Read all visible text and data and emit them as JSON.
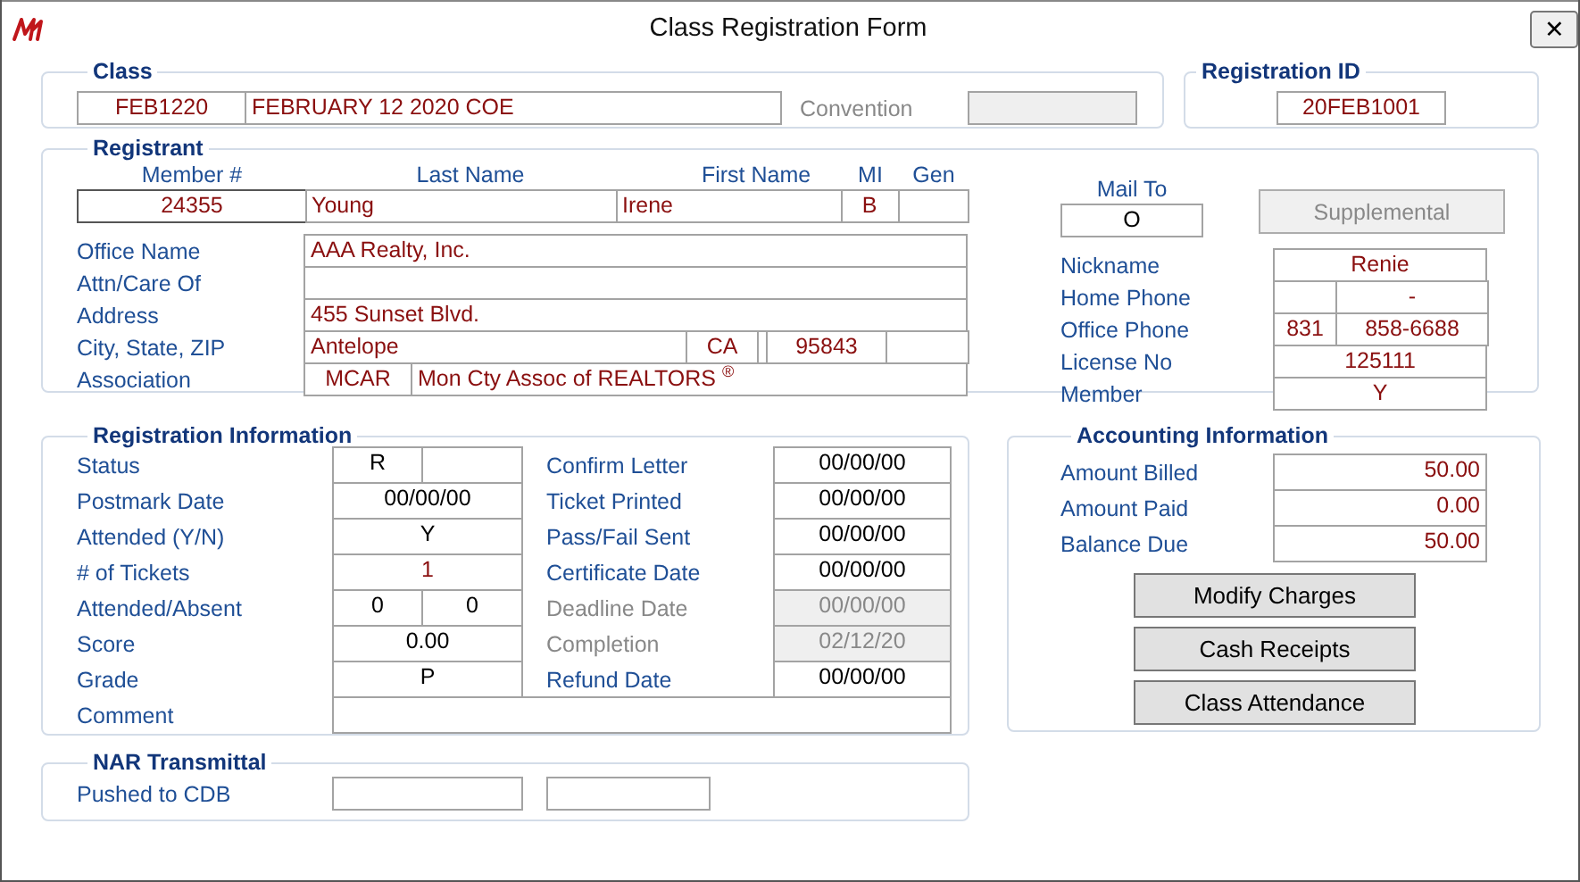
{
  "window": {
    "title": "Class Registration Form",
    "close_glyph": "✕"
  },
  "class_group": {
    "title": "Class",
    "code": "FEB1220",
    "name": "FEBRUARY 12 2020 COE",
    "convention": {
      "label": "Convention",
      "disabled": true
    }
  },
  "registration_id": {
    "title": "Registration ID",
    "value": "20FEB1001"
  },
  "registrant": {
    "title": "Registrant",
    "columns": [
      {
        "header": "Member #",
        "value": "24355"
      },
      {
        "header": "Last Name",
        "value": "Young"
      },
      {
        "header": "First Name",
        "value": "Irene"
      },
      {
        "header": "MI",
        "value": "B"
      },
      {
        "header": "Gen"
      }
    ],
    "mail_to": {
      "label": "Mail To",
      "value": "O"
    },
    "supplemental": {
      "label": "Supplemental",
      "disabled": true
    },
    "rows": [
      {
        "label": "Office Name",
        "kind": "single",
        "values": [
          "AAA Realty, Inc."
        ]
      },
      {
        "label": "Attn/Care Of",
        "kind": "single"
      },
      {
        "label": "Address",
        "kind": "single",
        "values": [
          "455 Sunset Blvd."
        ]
      },
      {
        "label": "City, State, ZIP",
        "kind": "city",
        "values": [
          "Antelope",
          "CA",
          "95843"
        ]
      },
      {
        "label": "Association",
        "kind": "association",
        "values": [
          "MCAR",
          "Mon Cty Assoc of REALTORS $^{®}$"
        ]
      }
    ],
    "contact_rows": [
      {
        "label": "Nickname",
        "kind": "single",
        "value": "Renie"
      },
      {
        "label": "Home Phone",
        "kind": "phone",
        "number": "-"
      },
      {
        "label": "Office Phone",
        "kind": "phone",
        "area": "831",
        "number": "858-6688"
      },
      {
        "label": "License No",
        "kind": "single",
        "value": "125111"
      },
      {
        "label": "Member",
        "kind": "single",
        "value": "Y"
      }
    ]
  },
  "registration_info": {
    "title": "Registration Information",
    "left_rows": [
      {
        "label": "Status",
        "kind": "pair",
        "values": [
          "R"
        ]
      },
      {
        "label": "Postmark Date",
        "kind": "single",
        "values": [
          "00/00/00"
        ]
      },
      {
        "label": "Attended (Y/N)",
        "kind": "single",
        "values": [
          "Y"
        ]
      },
      {
        "label": "# of Tickets",
        "kind": "single",
        "values": [
          "1"
        ]
      },
      {
        "label": "Attended/Absent",
        "kind": "pair",
        "values": [
          "0",
          "0"
        ]
      },
      {
        "label": "Score",
        "kind": "single",
        "values": [
          "0.00"
        ]
      },
      {
        "label": "Grade",
        "kind": "single",
        "values": [
          "P"
        ]
      }
    ],
    "right_rows": [
      {
        "label": "Confirm Letter",
        "value": "00/00/00",
        "disabled": false
      },
      {
        "label": "Ticket Printed",
        "value": "00/00/00",
        "disabled": false
      },
      {
        "label": "Pass/Fail Sent",
        "value": "00/00/00",
        "disabled": false
      },
      {
        "label": "Certificate Date",
        "value": "00/00/00",
        "disabled": false
      },
      {
        "label": "Deadline Date",
        "value": "00/00/00",
        "disabled": true
      },
      {
        "label": "Completion",
        "value": "02/12/20",
        "disabled": true
      },
      {
        "label": "Refund Date",
        "value": "00/00/00",
        "disabled": false
      }
    ],
    "comment": {
      "label": "Comment"
    }
  },
  "accounting": {
    "title": "Accounting Information",
    "rows": [
      {
        "label": "Amount Billed",
        "value": "50.00"
      },
      {
        "label": "Amount Paid",
        "value": "0.00"
      },
      {
        "label": "Balance Due",
        "value": "50.00"
      }
    ],
    "buttons": [
      "Modify Charges",
      "Cash Receipts",
      "Class Attendance"
    ]
  },
  "nar_transmittal": {
    "title": "NAR Transmittal",
    "label": "Pushed to CDB"
  }
}
